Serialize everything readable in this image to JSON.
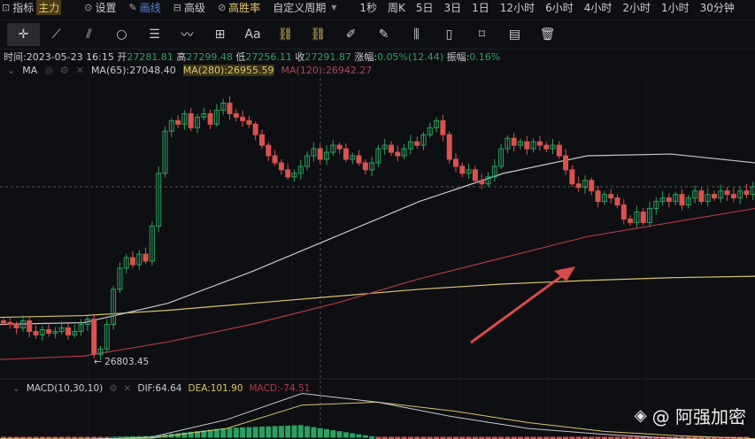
{
  "menu": {
    "indicator": "指标",
    "main": "主力",
    "settings": "设置",
    "draw": "画线",
    "advanced": "高级",
    "winrate": "高胜率",
    "custom_period": "自定义周期",
    "periods": [
      "1秒",
      "周K",
      "5日",
      "3日",
      "1日",
      "12小时",
      "6小时",
      "4小时",
      "2小时",
      "1小时",
      "30分钟"
    ]
  },
  "toolbar": {
    "icons": [
      "crosshair-icon",
      "trendline-icon",
      "parallel-channel-icon",
      "circle-icon",
      "horizontal-lines-icon",
      "wave-icon",
      "rectangle-icon",
      "text-icon",
      "magnet-icon",
      "lock-draw-icon",
      "ruler-icon",
      "pen-icon",
      "candles-icon",
      "lock-icon",
      "bookmark-icon",
      "edit-icon",
      "trash-icon"
    ],
    "text_tool": "Aa"
  },
  "info": {
    "time_label": "时间:",
    "time": "2023-05-23 16:15",
    "open_label": "开",
    "open": "27281.81",
    "high_label": "高",
    "high": "27299.48",
    "low_label": "低",
    "low": "27256.11",
    "close_label": "收",
    "close": "27291.87",
    "change_label": "涨幅:",
    "change": "0.05%(12.44)",
    "amp_label": "振幅:",
    "amp": "0.16%"
  },
  "ma": {
    "label": "MA",
    "ma65": "MA(65):27048.40",
    "ma280": "MA(280):26955.59",
    "ma120": "MA(120):26942.27"
  },
  "macd": {
    "label": "MACD(10,30,10)",
    "dif": "DIF:64.64",
    "dea": "DEA:101.90",
    "macd": "MACD:-74.51"
  },
  "low_marker": "← 26803.45",
  "watermark": "@ 阿强加密",
  "colors": {
    "up": "#2ca061",
    "down": "#d9534f",
    "ma65": "#c8c8d0",
    "ma280": "#d8c46a",
    "ma120": "#b0384a",
    "arrow": "#d94a48"
  },
  "chart_data": {
    "type": "candlestick",
    "closes": [
      26905,
      26900,
      26890,
      26910,
      26880,
      26870,
      26885,
      26875,
      26880,
      26890,
      26870,
      26880,
      26900,
      26915,
      26815,
      26830,
      26900,
      27000,
      27060,
      27090,
      27070,
      27100,
      27080,
      27180,
      27330,
      27450,
      27480,
      27470,
      27500,
      27460,
      27490,
      27500,
      27470,
      27510,
      27530,
      27500,
      27490,
      27480,
      27470,
      27440,
      27410,
      27380,
      27360,
      27340,
      27320,
      27330,
      27350,
      27380,
      27400,
      27370,
      27390,
      27410,
      27400,
      27370,
      27380,
      27360,
      27340,
      27360,
      27400,
      27410,
      27390,
      27380,
      27400,
      27420,
      27410,
      27440,
      27460,
      27480,
      27440,
      27370,
      27350,
      27330,
      27340,
      27310,
      27300,
      27320,
      27350,
      27400,
      27430,
      27410,
      27420,
      27400,
      27420,
      27410,
      27400,
      27410,
      27380,
      27340,
      27300,
      27290,
      27310,
      27280,
      27250,
      27270,
      27260,
      27240,
      27200,
      27190,
      27220,
      27190,
      27230,
      27250,
      27260,
      27250,
      27270,
      27240,
      27260,
      27280,
      27250,
      27270,
      27260,
      27280,
      27270,
      27260,
      27280,
      27270,
      27291.87
    ],
    "ma65": [
      26900,
      26905,
      26960,
      27050,
      27150,
      27250,
      27330,
      27380,
      27385,
      27360
    ],
    "ma280": [
      26920,
      26925,
      26940,
      26960,
      26980,
      27000,
      27015,
      27025,
      27033,
      27037
    ],
    "ma120": [
      26800,
      26810,
      26850,
      26900,
      26960,
      27030,
      27090,
      27150,
      27190,
      27230
    ],
    "macd_dif": [
      -10,
      -8,
      0,
      60,
      150,
      120,
      70,
      30,
      10,
      -5,
      -10
    ],
    "macd_dea": [
      -5,
      -6,
      -3,
      30,
      110,
      120,
      90,
      50,
      20,
      5,
      -5
    ]
  }
}
